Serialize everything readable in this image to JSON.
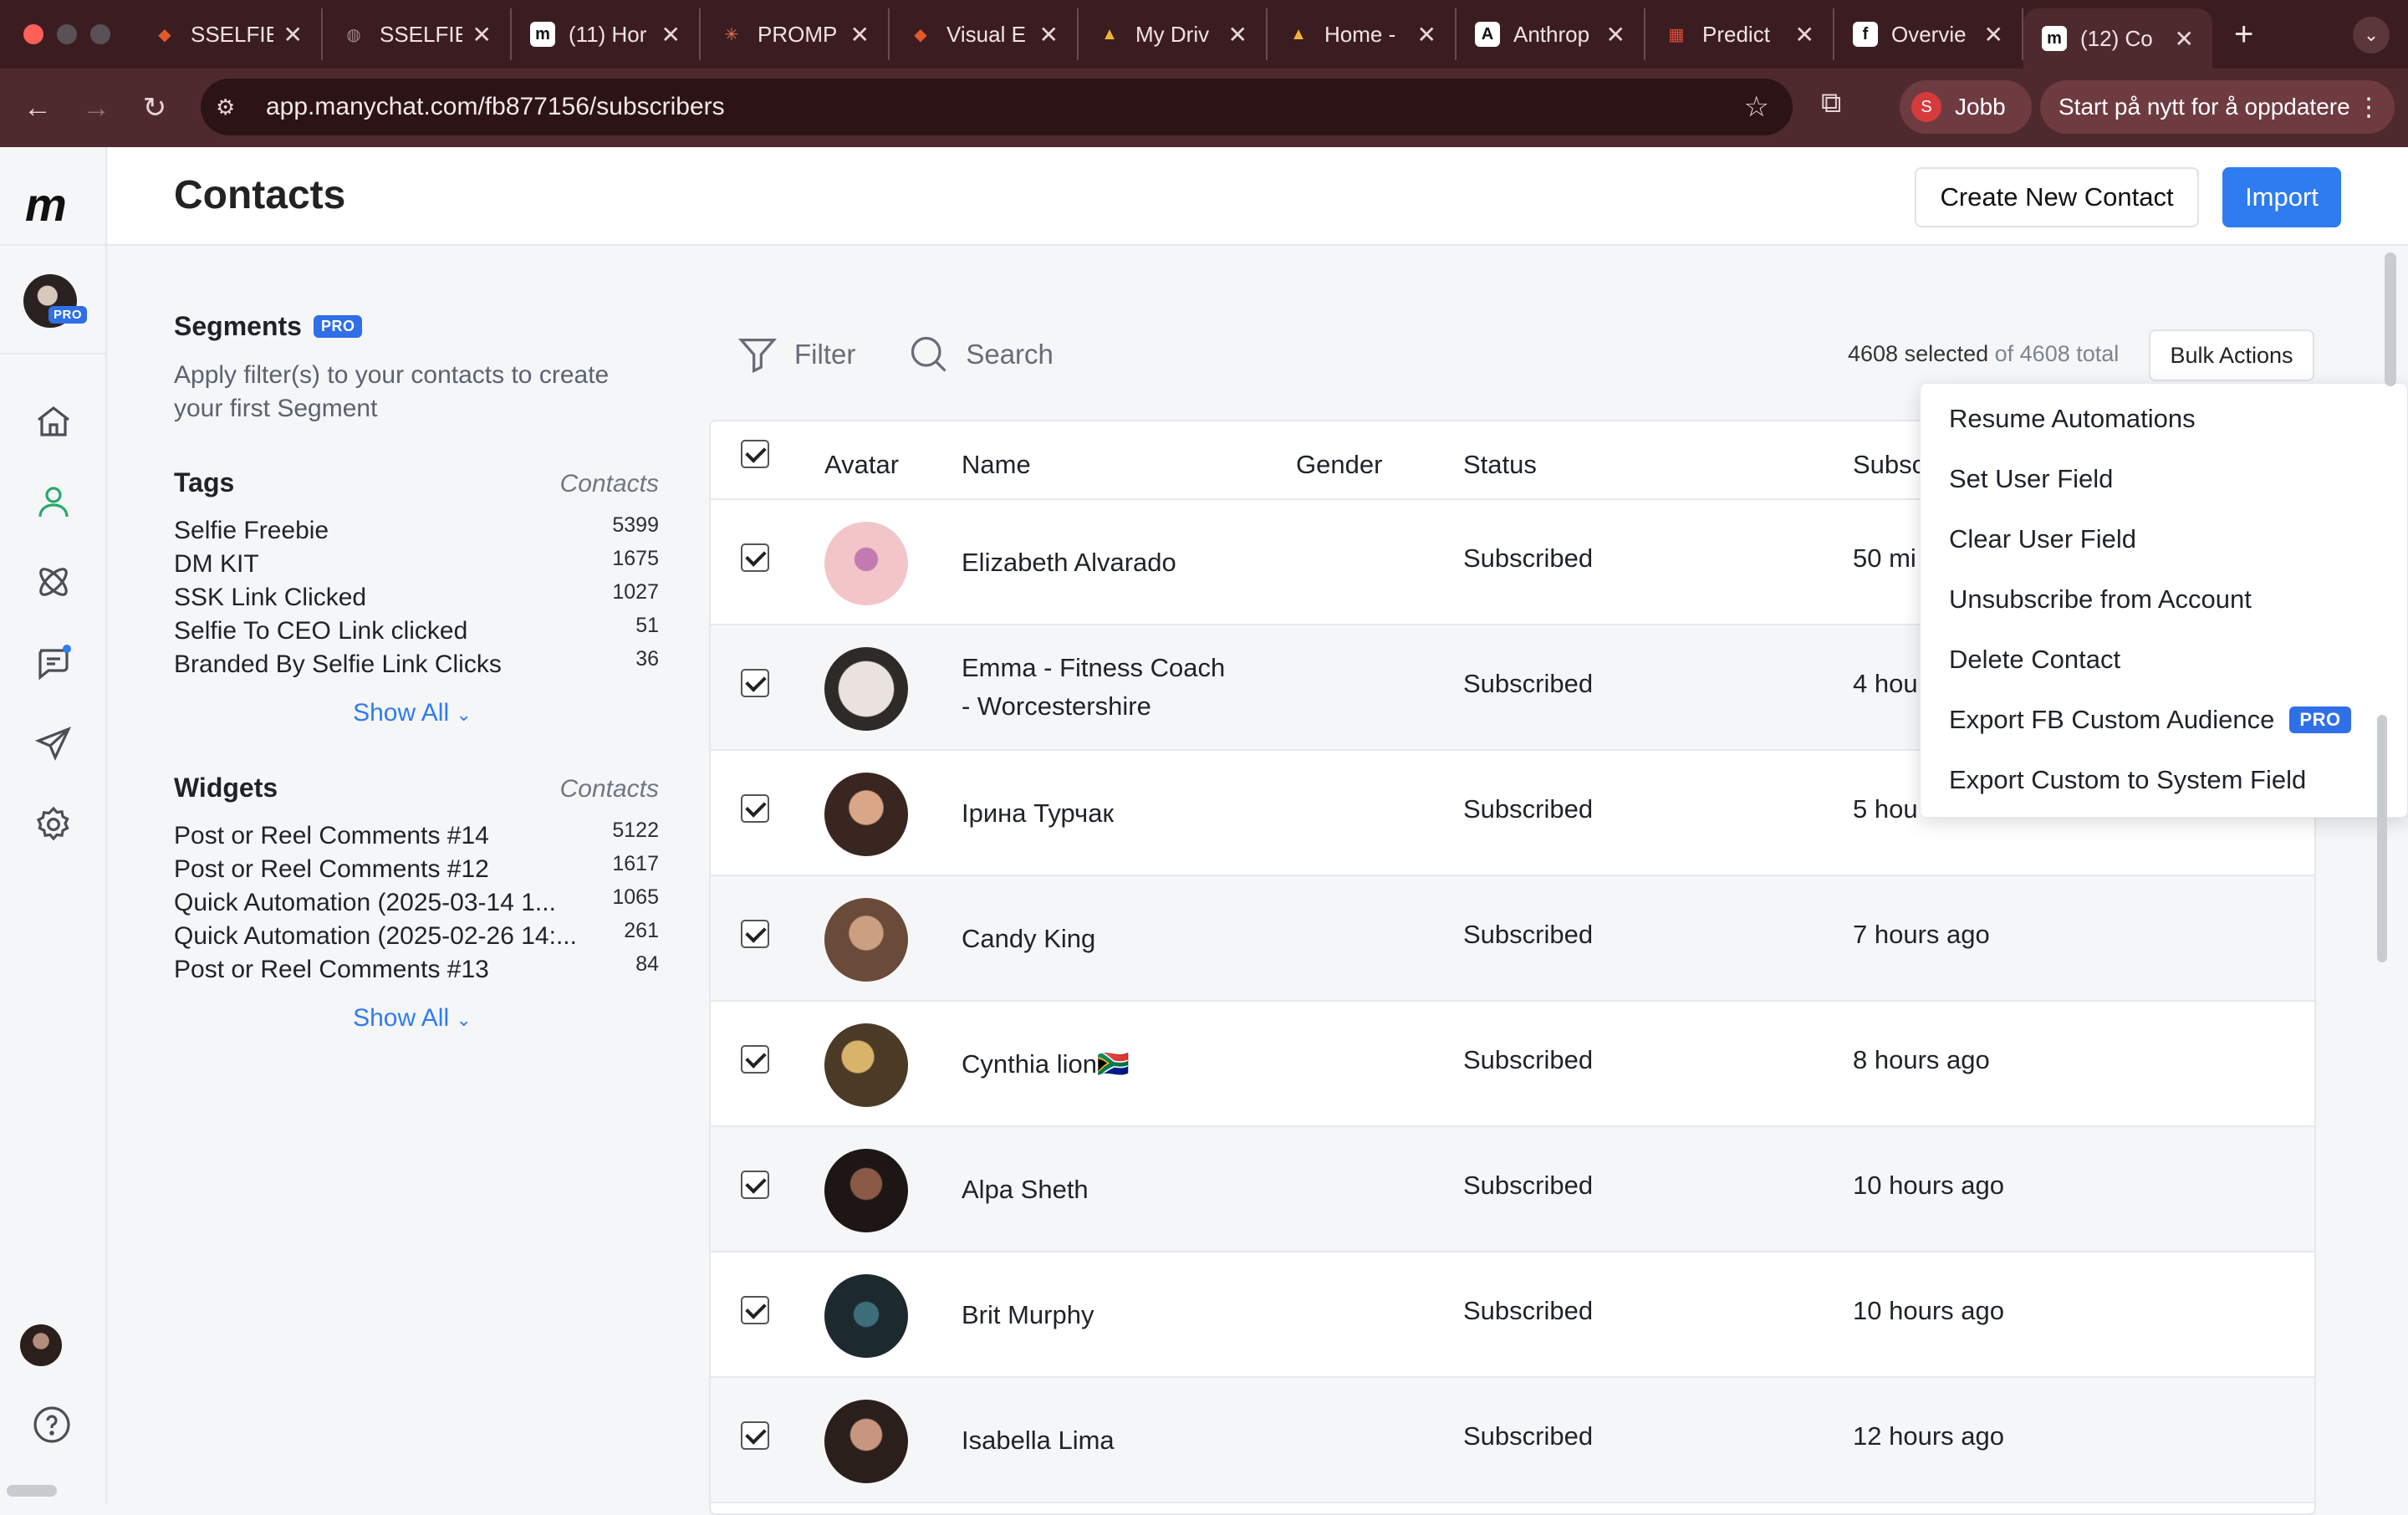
{
  "browser": {
    "tabs": [
      {
        "title": "SSELFIE",
        "icon": "figma-icon",
        "color": "#e25a2a"
      },
      {
        "title": "SSELFIE",
        "icon": "globe-icon",
        "color": "#9a8a8c"
      },
      {
        "title": "(11) Hor",
        "icon": "manychat-icon",
        "color": "#ffffff"
      },
      {
        "title": "PROMP",
        "icon": "claude-icon",
        "color": "#e8744a"
      },
      {
        "title": "Visual E",
        "icon": "figma-icon",
        "color": "#e25a2a"
      },
      {
        "title": "My Driv",
        "icon": "drive-icon",
        "color": "#f2b233"
      },
      {
        "title": "Home -",
        "icon": "drive-icon",
        "color": "#f2b233"
      },
      {
        "title": "Anthrop",
        "icon": "anthropic-icon",
        "color": "#ffffff"
      },
      {
        "title": "Predict",
        "icon": "predict-icon",
        "color": "#e34a3a"
      },
      {
        "title": "Overvie",
        "icon": "facebook-icon",
        "color": "#ffffff"
      },
      {
        "title": "(12) Co",
        "icon": "manychat-icon",
        "color": "#ffffff",
        "active": true
      }
    ],
    "url": "app.manychat.com/fb877156/subscribers",
    "profile_initial": "S",
    "profile_name": "Jobb",
    "restart_label": "Start på nytt for å oppdatere"
  },
  "app": {
    "logo": "m",
    "pro_label": "PRO",
    "page_title": "Contacts",
    "create_button": "Create New Contact",
    "import_button": "Import"
  },
  "segments": {
    "title": "Segments",
    "badge": "PRO",
    "description": "Apply filter(s) to your contacts to create your first Segment"
  },
  "tags": {
    "title": "Tags",
    "column": "Contacts",
    "items": [
      {
        "label": "Selfie Freebie",
        "count": "5399"
      },
      {
        "label": "DM KIT",
        "count": "1675"
      },
      {
        "label": "SSK Link Clicked",
        "count": "1027"
      },
      {
        "label": "Selfie To CEO Link clicked",
        "count": "51"
      },
      {
        "label": "Branded By Selfie Link Clicks",
        "count": "36"
      }
    ],
    "show_all": "Show All"
  },
  "widgets": {
    "title": "Widgets",
    "column": "Contacts",
    "items": [
      {
        "label": "Post or Reel Comments #14",
        "count": "5122"
      },
      {
        "label": "Post or Reel Comments #12",
        "count": "1617"
      },
      {
        "label": "Quick Automation (2025-03-14 1...",
        "count": "1065"
      },
      {
        "label": "Quick Automation (2025-02-26 14:...",
        "count": "261"
      },
      {
        "label": "Post or Reel Comments #13",
        "count": "84"
      }
    ],
    "show_all": "Show All"
  },
  "toolbar": {
    "filter": "Filter",
    "search": "Search",
    "selected": "4608 selected",
    "total": " of 4608 total",
    "bulk_actions": "Bulk Actions"
  },
  "table": {
    "headers": {
      "avatar": "Avatar",
      "name": "Name",
      "gender": "Gender",
      "status": "Status",
      "subscribed": "Subsc"
    },
    "rows": [
      {
        "name": "Elizabeth Alvarado",
        "status": "Subscribed",
        "time": "50 mi"
      },
      {
        "name": "Emma - Fitness Coach",
        "name2": "- Worcestershire",
        "status": "Subscribed",
        "time": "4 hou"
      },
      {
        "name": "Ірина Турчак",
        "status": "Subscribed",
        "time": "5 hou"
      },
      {
        "name": "Candy King",
        "status": "Subscribed",
        "time": "7 hours ago"
      },
      {
        "name": "Cynthia lion🇿🇦",
        "status": "Subscribed",
        "time": "8 hours ago"
      },
      {
        "name": "Alpa Sheth",
        "status": "Subscribed",
        "time": "10 hours ago"
      },
      {
        "name": "Brit Murphy",
        "status": "Subscribed",
        "time": "10 hours ago"
      },
      {
        "name": "Isabella Lima",
        "status": "Subscribed",
        "time": "12 hours ago"
      }
    ]
  },
  "bulk_menu": {
    "items": [
      "Resume Automations",
      "Set User Field",
      "Clear User Field",
      "Unsubscribe from Account",
      "Delete Contact",
      "Export FB Custom Audience",
      "Export Custom to System Field"
    ],
    "pro_badge": "PRO"
  }
}
